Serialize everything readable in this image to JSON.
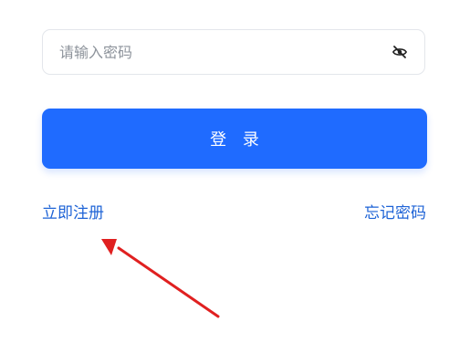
{
  "password_field": {
    "placeholder": "请输入密码",
    "value": "",
    "toggle_icon": "eye-off-icon"
  },
  "login_button": {
    "label": "登 录"
  },
  "links": {
    "register": "立即注册",
    "forgot_password": "忘记密码"
  },
  "colors": {
    "primary": "#1f6bff",
    "link": "#1e63d6",
    "annotation": "#e02020"
  },
  "annotation": {
    "icon": "red-arrow-annotation"
  }
}
